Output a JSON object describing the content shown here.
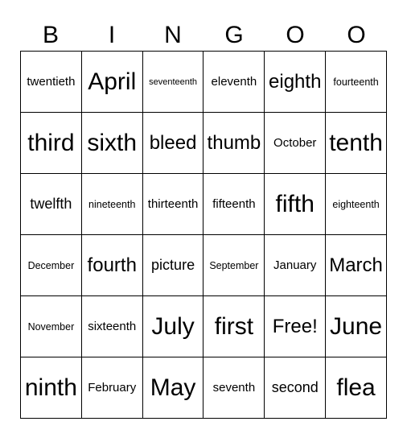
{
  "header": [
    "B",
    "I",
    "N",
    "G",
    "O",
    "O"
  ],
  "cells": [
    [
      "twentieth",
      "April",
      "seventeenth",
      "eleventh",
      "eighth",
      "fourteenth"
    ],
    [
      "third",
      "sixth",
      "bleed",
      "thumb",
      "October",
      "tenth"
    ],
    [
      "twelfth",
      "nineteenth",
      "thirteenth",
      "fifteenth",
      "fifth",
      "eighteenth"
    ],
    [
      "December",
      "fourth",
      "picture",
      "September",
      "January",
      "March"
    ],
    [
      "November",
      "sixteenth",
      "July",
      "first",
      "Free!",
      "June"
    ],
    [
      "ninth",
      "February",
      "May",
      "seventh",
      "second",
      "flea"
    ]
  ]
}
